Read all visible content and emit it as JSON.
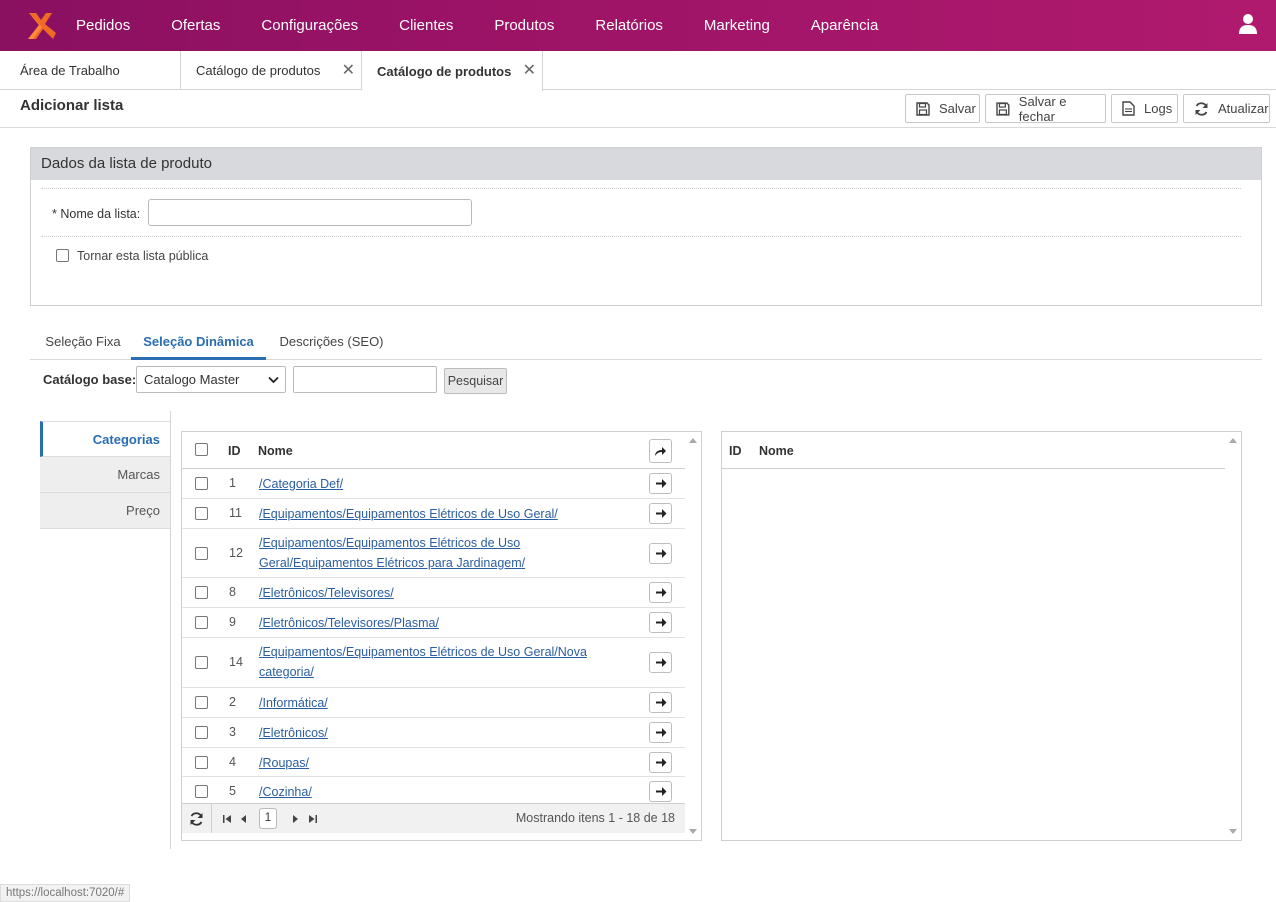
{
  "nav": {
    "items": [
      "Pedidos",
      "Ofertas",
      "Configurações",
      "Clientes",
      "Produtos",
      "Relatórios",
      "Marketing",
      "Aparência"
    ]
  },
  "window_tabs": [
    {
      "label": "Área de Trabalho",
      "closable": false
    },
    {
      "label": "Catálogo de produtos",
      "closable": true
    },
    {
      "label": "Catálogo de produtos",
      "closable": true,
      "active": true
    }
  ],
  "page": {
    "title": "Adicionar lista"
  },
  "toolbar": {
    "save": "Salvar",
    "save_close": "Salvar e fechar",
    "logs": "Logs",
    "refresh": "Atualizar"
  },
  "panel": {
    "title": "Dados da lista de produto",
    "name_label": "* Nome da lista:",
    "name_value": "",
    "public_label": "Tornar esta lista pública"
  },
  "subtabs": [
    "Seleção Fixa",
    "Seleção Dinâmica",
    "Descrições (SEO)"
  ],
  "catalog": {
    "label": "Catálogo base:",
    "selected": "Catalogo Master",
    "search_value": "",
    "search_button": "Pesquisar"
  },
  "side_tabs": [
    "Categorias",
    "Marcas",
    "Preço"
  ],
  "grid": {
    "col_id": "ID",
    "col_name": "Nome",
    "rows": [
      {
        "id": "1",
        "name": "/Categoria Def/"
      },
      {
        "id": "11",
        "name": "/Equipamentos/Equipamentos Elétricos de Uso Geral/"
      },
      {
        "id": "12",
        "name": "/Equipamentos/Equipamentos Elétricos de Uso Geral/Equipamentos Elétricos para Jardinagem/"
      },
      {
        "id": "8",
        "name": "/Eletrônicos/Televisores/"
      },
      {
        "id": "9",
        "name": "/Eletrônicos/Televisores/Plasma/"
      },
      {
        "id": "14",
        "name": "/Equipamentos/Equipamentos Elétricos de Uso Geral/Nova categoria/"
      },
      {
        "id": "2",
        "name": "/Informática/"
      },
      {
        "id": "3",
        "name": "/Eletrônicos/"
      },
      {
        "id": "4",
        "name": "/Roupas/"
      },
      {
        "id": "5",
        "name": "/Cozinha/"
      }
    ],
    "page": "1",
    "pager_text": "Mostrando itens 1 - 18 de 18"
  },
  "selected_grid": {
    "col_id": "ID",
    "col_name": "Nome"
  },
  "status_url": "https://localhost:7020/#",
  "colors": {
    "accent": "#2a6db0",
    "topbar": "#9c1366",
    "link": "#2b5ea0"
  }
}
